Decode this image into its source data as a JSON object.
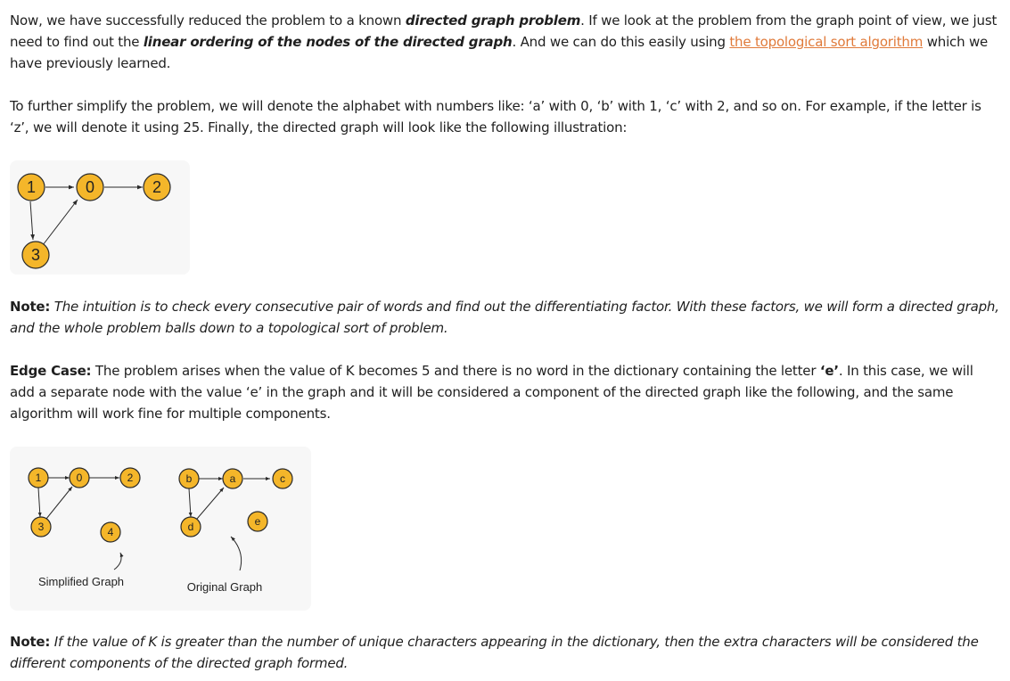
{
  "p1": {
    "t1": "Now, we have successfully reduced the problem to a known ",
    "b1": "directed graph problem",
    "t2": ". If we look at the problem from the graph point of view, we just need to find out the ",
    "b2": "linear ordering of the nodes of the directed graph",
    "t3": ". And we can do this easily using ",
    "link": "the topological sort algorithm",
    "t4": " which we have previously learned."
  },
  "p2": {
    "text": "To further simplify the problem, we will denote the alphabet with numbers like: ‘a’ with 0, ‘b’ with 1, ‘c’ with 2, and so on. For example, if the letter is ‘z’, we will denote it using 25. Finally, the directed graph will look like the following illustration:"
  },
  "figure1": {
    "nodes": [
      "1",
      "0",
      "2",
      "3"
    ]
  },
  "note1": {
    "label": "Note:",
    "text": " The intuition is to check every consecutive pair of words and find out the differentiating factor. With these factors, we will form a directed graph, and the whole problem balls down to a topological sort of problem."
  },
  "edgecase": {
    "label": "Edge Case:",
    "t1": " The problem arises when the value of K becomes 5 and there is no word in the dictionary containing the letter ",
    "bold": "‘e’",
    "t2": ". In this case, we will add a separate node with the value ‘e’ in the graph and it will be considered a component of the directed graph like the following, and the same algorithm will work fine for multiple components."
  },
  "figure2": {
    "simplified_nodes": [
      "1",
      "0",
      "2",
      "3",
      "4"
    ],
    "original_nodes": [
      "b",
      "a",
      "c",
      "d",
      "e"
    ],
    "simplified_caption": "Simplified Graph",
    "original_caption": "Original Graph"
  },
  "note2": {
    "label": "Note:",
    "text": " If the value of K is greater than the number of unique characters appearing in the dictionary, then the extra characters will be considered the different components of the directed graph formed."
  },
  "colors": {
    "node_fill": "#f4b62a",
    "link": "#e07a3a"
  }
}
